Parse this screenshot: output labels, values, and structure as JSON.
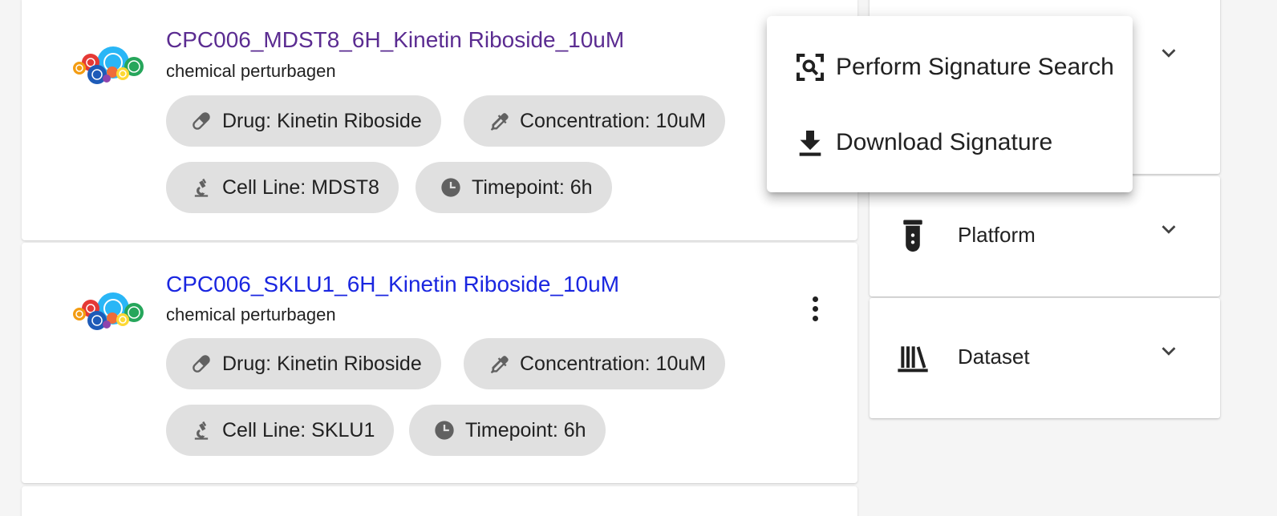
{
  "results": [
    {
      "title": "CPC006_MDST8_6H_Kinetin Riboside_10uM",
      "subtitle": "chemical perturbagen",
      "chips": {
        "drug": "Drug: Kinetin Riboside",
        "concentration": "Concentration: 10uM",
        "cell_line": "Cell Line: MDST8",
        "timepoint": "Timepoint: 6h"
      }
    },
    {
      "title": "CPC006_SKLU1_6H_Kinetin Riboside_10uM",
      "subtitle": "chemical perturbagen",
      "chips": {
        "drug": "Drug: Kinetin Riboside",
        "concentration": "Concentration: 10uM",
        "cell_line": "Cell Line: SKLU1",
        "timepoint": "Timepoint: 6h"
      }
    }
  ],
  "menu": {
    "items": [
      "Perform Signature Search",
      "Download Signature"
    ]
  },
  "filters": [
    "Platform",
    "Dataset"
  ],
  "colors": {
    "visited_link": "#5b2c91",
    "link": "#1a26e0",
    "chip_bg": "#e0e0e0",
    "icon": "#616161"
  }
}
